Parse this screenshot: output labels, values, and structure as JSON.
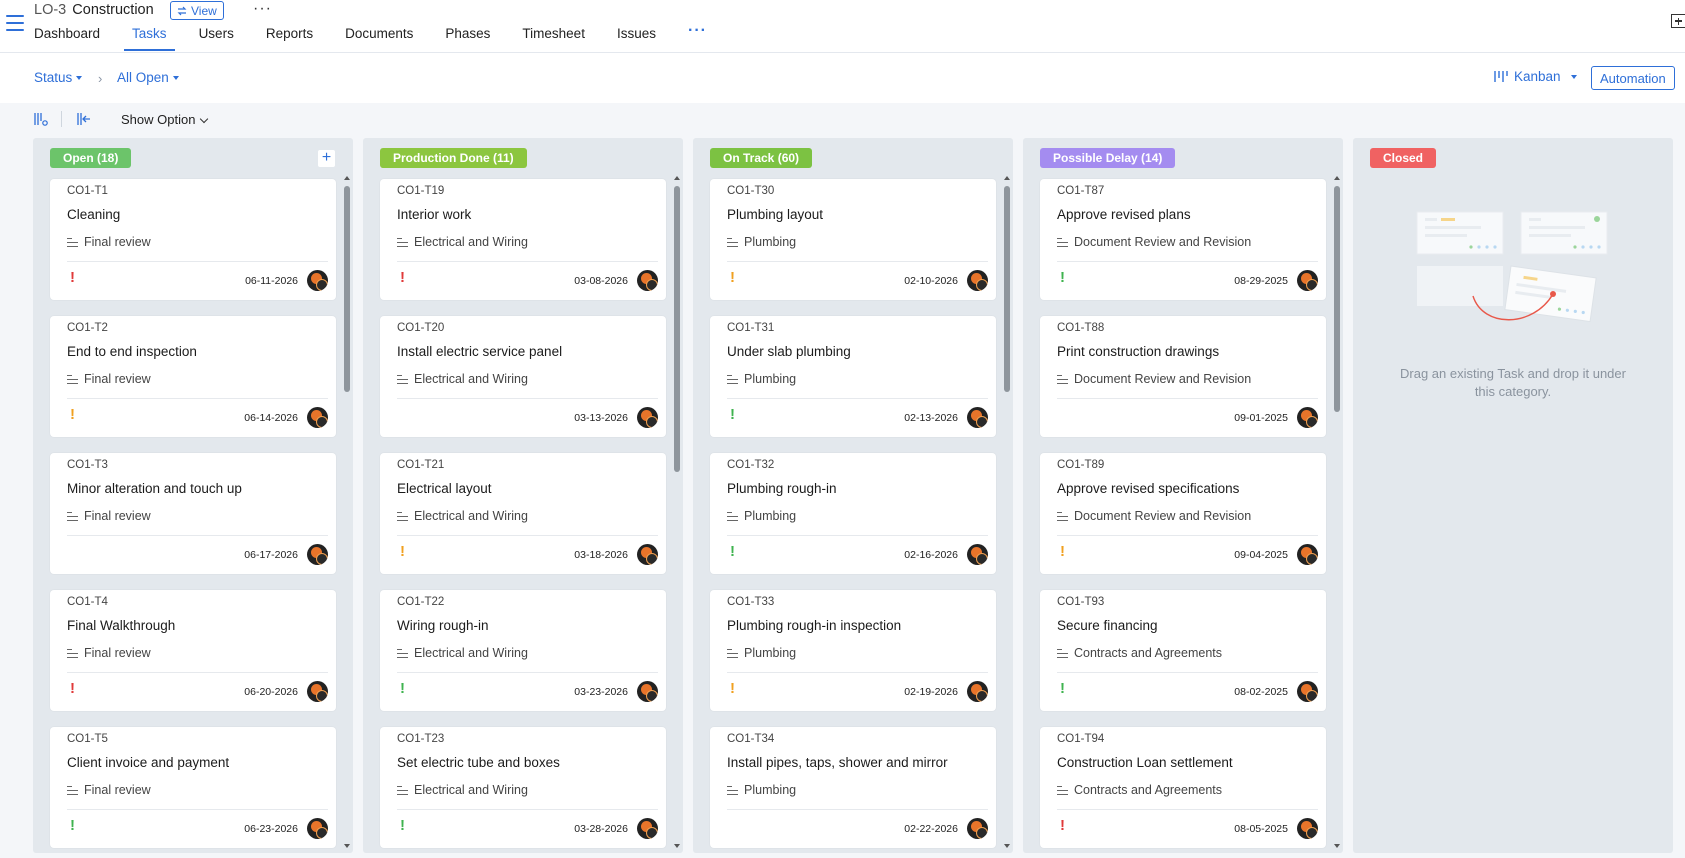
{
  "header": {
    "project_code": "LO-3",
    "project_name": "Construction",
    "view_label": "View",
    "more_label": "···"
  },
  "tabs": [
    {
      "label": "Dashboard",
      "active": false
    },
    {
      "label": "Tasks",
      "active": true
    },
    {
      "label": "Users",
      "active": false
    },
    {
      "label": "Reports",
      "active": false
    },
    {
      "label": "Documents",
      "active": false
    },
    {
      "label": "Phases",
      "active": false
    },
    {
      "label": "Timesheet",
      "active": false
    },
    {
      "label": "Issues",
      "active": false
    }
  ],
  "tabs_more": "···",
  "filter": {
    "group_by": "Status",
    "separator": "›",
    "view": "All Open",
    "layout": "Kanban",
    "automation": "Automation",
    "show_option": "Show Option"
  },
  "colors": {
    "accent": "#2e6fd8",
    "prio_high": "#e03a3a",
    "prio_medium": "#f0a020",
    "prio_low": "#3fb34f"
  },
  "columns": [
    {
      "label": "Open (18)",
      "color": "#6cc46a",
      "show_add": true,
      "cards": [
        {
          "id": "CO1-T1",
          "name": "Cleaning",
          "list": "Final review",
          "priority": "high",
          "due": "06-11-2026"
        },
        {
          "id": "CO1-T2",
          "name": "End to end inspection",
          "list": "Final review",
          "priority": "medium",
          "due": "06-14-2026"
        },
        {
          "id": "CO1-T3",
          "name": "Minor alteration and touch up",
          "list": "Final review",
          "priority": "none",
          "due": "06-17-2026"
        },
        {
          "id": "CO1-T4",
          "name": "Final Walkthrough",
          "list": "Final review",
          "priority": "high",
          "due": "06-20-2026"
        },
        {
          "id": "CO1-T5",
          "name": "Client invoice and payment",
          "list": "Final review",
          "priority": "low",
          "due": "06-23-2026"
        }
      ]
    },
    {
      "label": "Production Done (11)",
      "color": "#8cc63f",
      "show_add": false,
      "cards": [
        {
          "id": "CO1-T19",
          "name": "Interior work",
          "list": "Electrical and Wiring",
          "priority": "high",
          "due": "03-08-2026"
        },
        {
          "id": "CO1-T20",
          "name": "Install electric service panel",
          "list": "Electrical and Wiring",
          "priority": "none",
          "due": "03-13-2026"
        },
        {
          "id": "CO1-T21",
          "name": "Electrical layout",
          "list": "Electrical and Wiring",
          "priority": "medium",
          "due": "03-18-2026"
        },
        {
          "id": "CO1-T22",
          "name": "Wiring rough-in",
          "list": "Electrical and Wiring",
          "priority": "low",
          "due": "03-23-2026"
        },
        {
          "id": "CO1-T23",
          "name": "Set electric tube and boxes",
          "list": "Electrical and Wiring",
          "priority": "low",
          "due": "03-28-2026"
        }
      ]
    },
    {
      "label": "On Track (60)",
      "color": "#7cc242",
      "show_add": false,
      "cards": [
        {
          "id": "CO1-T30",
          "name": "Plumbing layout",
          "list": "Plumbing",
          "priority": "medium",
          "due": "02-10-2026"
        },
        {
          "id": "CO1-T31",
          "name": "Under slab plumbing",
          "list": "Plumbing",
          "priority": "low",
          "due": "02-13-2026"
        },
        {
          "id": "CO1-T32",
          "name": "Plumbing rough-in",
          "list": "Plumbing",
          "priority": "low",
          "due": "02-16-2026"
        },
        {
          "id": "CO1-T33",
          "name": "Plumbing rough-in inspection",
          "list": "Plumbing",
          "priority": "medium",
          "due": "02-19-2026"
        },
        {
          "id": "CO1-T34",
          "name": "Install pipes, taps, shower and mirror",
          "list": "Plumbing",
          "priority": "none",
          "due": "02-22-2026"
        }
      ]
    },
    {
      "label": "Possible Delay (14)",
      "color": "#a48cf0",
      "show_add": false,
      "cards": [
        {
          "id": "CO1-T87",
          "name": "Approve revised plans",
          "list": "Document Review and Revision",
          "priority": "low",
          "due": "08-29-2025"
        },
        {
          "id": "CO1-T88",
          "name": "Print construction drawings",
          "list": "Document Review and Revision",
          "priority": "none",
          "due": "09-01-2025"
        },
        {
          "id": "CO1-T89",
          "name": "Approve revised specifications",
          "list": "Document Review and Revision",
          "priority": "medium",
          "due": "09-04-2025"
        },
        {
          "id": "CO1-T93",
          "name": "Secure financing",
          "list": "Contracts and Agreements",
          "priority": "low",
          "due": "08-02-2025"
        },
        {
          "id": "CO1-T94",
          "name": "Construction Loan settlement",
          "list": "Contracts and Agreements",
          "priority": "high",
          "due": "08-05-2025"
        }
      ]
    },
    {
      "label": "Closed",
      "color": "#f06262",
      "show_add": false,
      "cards": [],
      "empty_text": "Drag an existing Task and drop it under this category."
    }
  ]
}
